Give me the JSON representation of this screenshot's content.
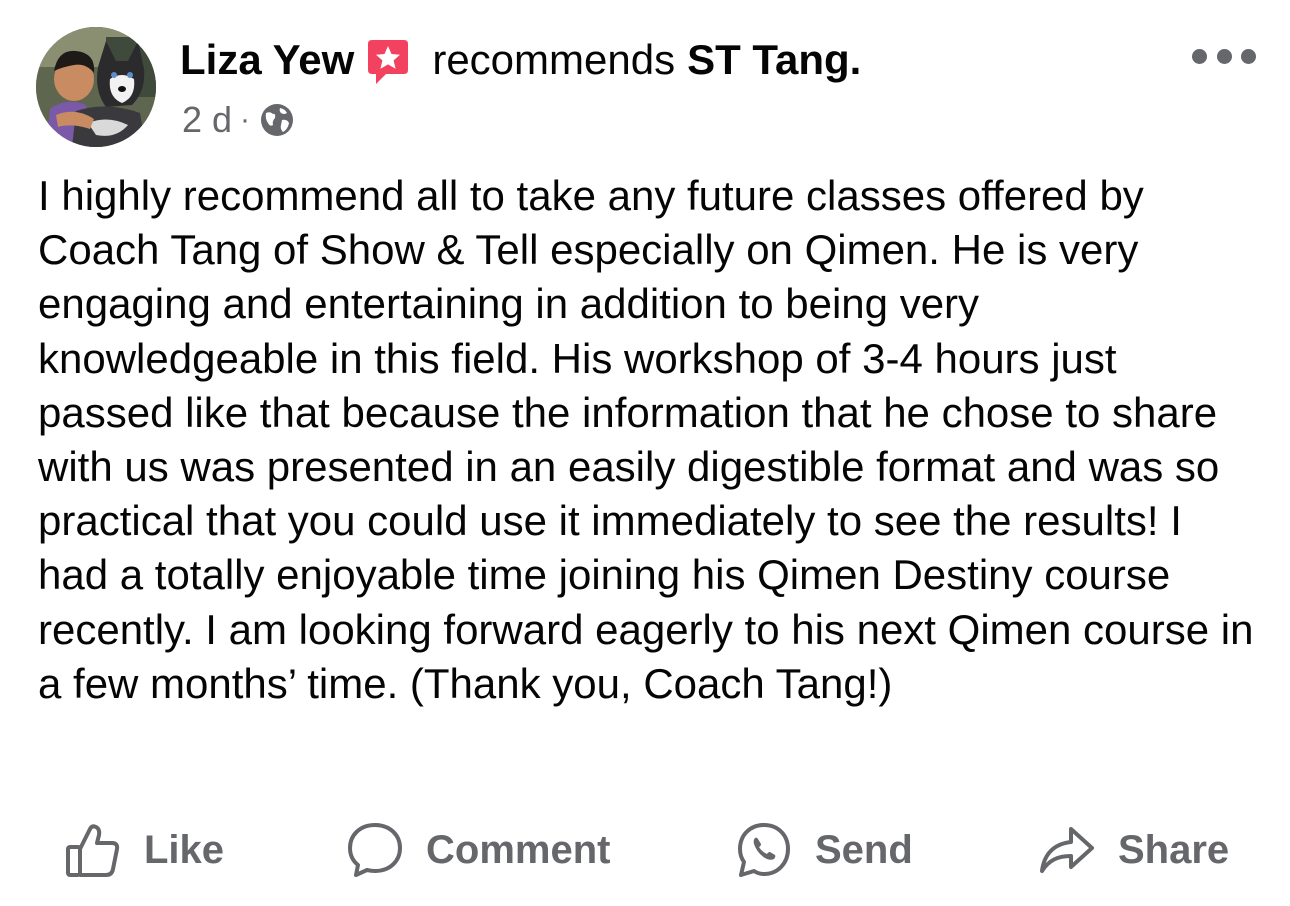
{
  "author": {
    "name": "Liza Yew",
    "avatar_icon": "user-photo-with-husky"
  },
  "recommendation": {
    "verb": "recommends",
    "page_name": "ST Tang.",
    "badge_icon": "recommend-star-icon",
    "badge_color": "#f3425f"
  },
  "meta": {
    "time": "2 d",
    "separator": "·",
    "audience_icon": "globe-icon"
  },
  "more_icon": "more-options-icon",
  "post": {
    "text": "I highly recommend all to take any future classes offered by Coach Tang of Show & Tell especially on Qimen. He is very engaging and entertaining in addition to being very knowledgeable in this field. His workshop of 3-4 hours just passed like that because the information that he chose to share with us was presented in an easily digestible format and was so practical that you could use it immediately to see the results! I had a totally enjoyable time joining his Qimen Destiny course recently. I am looking forward eagerly to his next Qimen course in a few months’ time. (Thank you, Coach Tang!)"
  },
  "actions": {
    "like_label": "Like",
    "comment_label": "Comment",
    "send_label": "Send",
    "share_label": "Share"
  },
  "colors": {
    "text": "#050505",
    "secondary": "#65676b",
    "background": "#ffffff"
  }
}
